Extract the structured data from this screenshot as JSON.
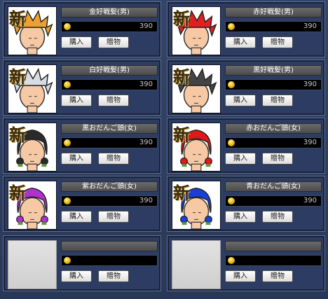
{
  "buttons": {
    "buy_label": "購入",
    "gift_label": "贈物"
  },
  "new_badge": "新",
  "items": [
    {
      "name": "金好戦髪(男)",
      "price": "390",
      "hair_color": "#f0a030",
      "style": "male"
    },
    {
      "name": "赤好戦髪(男)",
      "price": "390",
      "hair_color": "#e02020",
      "style": "male"
    },
    {
      "name": "白好戦髪(男)",
      "price": "390",
      "hair_color": "#d8dde4",
      "style": "male"
    },
    {
      "name": "黒好戦髪(男)",
      "price": "390",
      "hair_color": "#444444",
      "style": "male"
    },
    {
      "name": "黒おだんご頭(女)",
      "price": "390",
      "hair_color": "#2a2a2a",
      "style": "female"
    },
    {
      "name": "赤おだんご頭(女)",
      "price": "390",
      "hair_color": "#e01818",
      "style": "female"
    },
    {
      "name": "紫おだんご頭(女)",
      "price": "390",
      "hair_color": "#b030d0",
      "style": "female"
    },
    {
      "name": "青おだんご頭(女)",
      "price": "390",
      "hair_color": "#1840d8",
      "style": "female"
    },
    {
      "name": "",
      "price": "",
      "hair_color": "",
      "style": "empty"
    },
    {
      "name": "",
      "price": "",
      "hair_color": "",
      "style": "empty"
    }
  ]
}
